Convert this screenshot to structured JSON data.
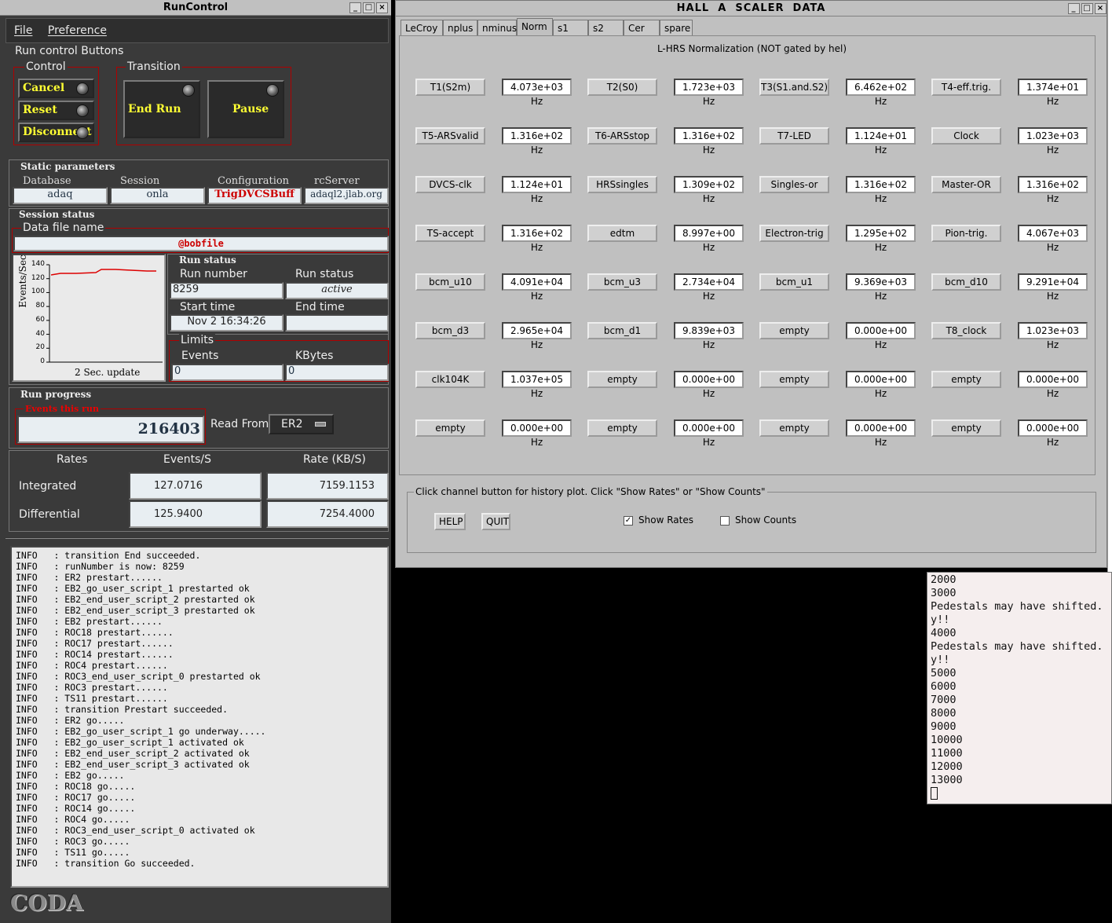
{
  "runcontrol": {
    "title": "RunControl",
    "menu": [
      "File",
      "Preference"
    ],
    "run_control_label": "Run control Buttons",
    "control_label": "Control",
    "transition_label": "Transition",
    "buttons": {
      "cancel": "Cancel",
      "reset": "Reset",
      "disconnect": "Disconnect",
      "end_run": "End Run",
      "pause": "Pause"
    },
    "static_params": {
      "label": "Static parameters",
      "headers": [
        "Database",
        "Session",
        "Configuration",
        "rcServer"
      ],
      "values": [
        "adaq",
        "onla",
        "TrigDVCSBuff",
        "adaql2.jlab.org"
      ]
    },
    "session_status": {
      "label": "Session status",
      "data_file_label": "Data file name",
      "data_file": "@bobfile"
    },
    "plot": {
      "ylabel": "Events/Sec",
      "update_label": "2 Sec. update",
      "yticks": [
        "140",
        "120",
        "100",
        "80",
        "60",
        "40",
        "20",
        "0"
      ]
    },
    "run_status": {
      "label": "Run status",
      "run_number_label": "Run number",
      "run_number": "8259",
      "run_status_label": "Run status",
      "run_status": "active",
      "start_time_label": "Start time",
      "start_time": "Nov 2 16:34:26",
      "end_time_label": "End time",
      "end_time": "",
      "limits_label": "Limits",
      "events_label": "Events",
      "events": "0",
      "kbytes_label": "KBytes",
      "kbytes": "0"
    },
    "run_progress": {
      "label": "Run progress",
      "events_this_run_label": "Events this run",
      "events_this_run": "216403",
      "read_from_label": "Read From:",
      "read_from": "ER2"
    },
    "rates": {
      "headers": [
        "Rates",
        "Events/S",
        "Rate (KB/S)"
      ],
      "integrated_label": "Integrated",
      "integrated_events": "127.0716",
      "integrated_rate": "7159.1153",
      "differential_label": "Differential",
      "differential_events": "125.9400",
      "differential_rate": "7254.4000"
    },
    "log": [
      "INFO   : transition End succeeded.",
      "INFO   : runNumber is now: 8259",
      "INFO   : ER2 prestart......",
      "INFO   : EB2_go_user_script_1 prestarted ok",
      "INFO   : EB2_end_user_script_2 prestarted ok",
      "INFO   : EB2_end_user_script_3 prestarted ok",
      "INFO   : EB2 prestart......",
      "INFO   : ROC18 prestart......",
      "INFO   : ROC17 prestart......",
      "INFO   : ROC14 prestart......",
      "INFO   : ROC4 prestart......",
      "INFO   : ROC3_end_user_script_0 prestarted ok",
      "INFO   : ROC3 prestart......",
      "INFO   : TS11 prestart......",
      "INFO   : transition Prestart succeeded.",
      "INFO   : ER2 go.....",
      "INFO   : EB2_go_user_script_1 go underway.....",
      "INFO   : EB2_go_user_script_1 activated ok",
      "INFO   : EB2_end_user_script_2 activated ok",
      "INFO   : EB2_end_user_script_3 activated ok",
      "INFO   : EB2 go.....",
      "INFO   : ROC18 go.....",
      "INFO   : ROC17 go.....",
      "INFO   : ROC14 go.....",
      "INFO   : ROC4 go.....",
      "INFO   : ROC3_end_user_script_0 activated ok",
      "INFO   : ROC3 go.....",
      "INFO   : TS11 go.....",
      "INFO   : transition Go succeeded."
    ],
    "logo": "CODA"
  },
  "scaler": {
    "title": "HALL  A  SCALER  DATA",
    "tabs": [
      "LeCroy",
      "nplus",
      "nminus",
      "Norm",
      "s1",
      "s2",
      "Cer",
      "spare"
    ],
    "active_tab": "Norm",
    "heading": "L-HRS Normalization (NOT gated by hel)",
    "channels": [
      [
        "T1(S2m)",
        "4.073e+03 Hz",
        "T2(S0)",
        "1.723e+03 Hz",
        "T3(S1.and.S2)",
        "6.462e+02 Hz",
        "T4-eff.trig.",
        "1.374e+01 Hz"
      ],
      [
        "T5-ARSvalid",
        "1.316e+02 Hz",
        "T6-ARSstop",
        "1.316e+02 Hz",
        "T7-LED",
        "1.124e+01 Hz",
        "Clock",
        "1.023e+03 Hz"
      ],
      [
        "DVCS-clk",
        "1.124e+01 Hz",
        "HRSsingles",
        "1.309e+02 Hz",
        "Singles-or",
        "1.316e+02 Hz",
        "Master-OR",
        "1.316e+02 Hz"
      ],
      [
        "TS-accept",
        "1.316e+02 Hz",
        "edtm",
        "8.997e+00 Hz",
        "Electron-trig",
        "1.295e+02 Hz",
        "Pion-trig.",
        "4.067e+03 Hz"
      ],
      [
        "bcm_u10",
        "4.091e+04 Hz",
        "bcm_u3",
        "2.734e+04 Hz",
        "bcm_u1",
        "9.369e+03 Hz",
        "bcm_d10",
        "9.291e+04 Hz"
      ],
      [
        "bcm_d3",
        "2.965e+04 Hz",
        "bcm_d1",
        "9.839e+03 Hz",
        "empty",
        "0.000e+00 Hz",
        "T8_clock",
        "1.023e+03 Hz"
      ],
      [
        "clk104K",
        "1.037e+05 Hz",
        "empty",
        "0.000e+00 Hz",
        "empty",
        "0.000e+00 Hz",
        "empty",
        "0.000e+00 Hz"
      ],
      [
        "empty",
        "0.000e+00 Hz",
        "empty",
        "0.000e+00 Hz",
        "empty",
        "0.000e+00 Hz",
        "empty",
        "0.000e+00 Hz"
      ]
    ],
    "hint": "Click channel button for history plot.  Click \"Show Rates\" or \"Show Counts\"",
    "help_label": "HELP",
    "quit_label": "QUIT",
    "show_rates_label": "Show Rates",
    "show_rates_checked": true,
    "show_counts_label": "Show Counts",
    "show_counts_checked": false
  },
  "terminal": {
    "lines": [
      "2000",
      "3000",
      "Pedestals may have shifted.",
      "y!!",
      "4000",
      "Pedestals may have shifted.",
      "y!!",
      "5000",
      "6000",
      "7000",
      "8000",
      "9000",
      "10000",
      "11000",
      "12000",
      "13000"
    ]
  }
}
